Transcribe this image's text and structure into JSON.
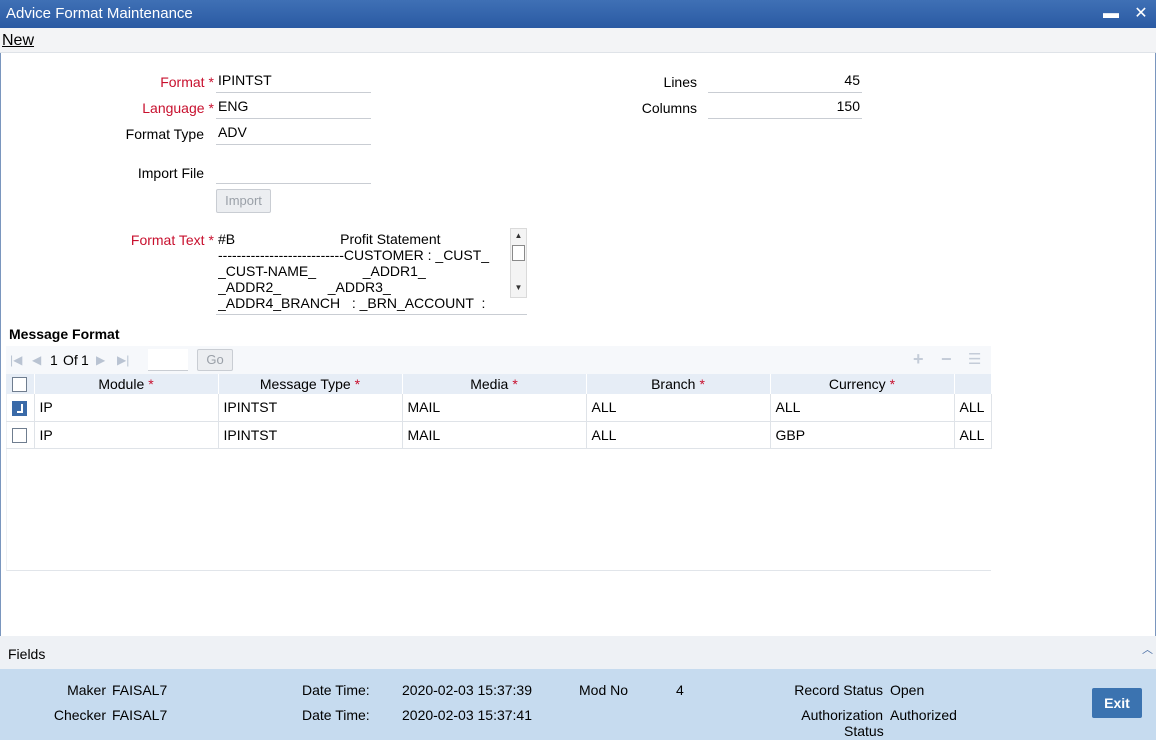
{
  "window": {
    "title": "Advice Format Maintenance",
    "minimize": "▬",
    "close": "✕"
  },
  "menu": {
    "new_label": "New"
  },
  "form": {
    "format_label": "Format",
    "format_value": "IPINTST",
    "language_label": "Language",
    "language_value": "ENG",
    "format_type_label": "Format Type",
    "format_type_value": "ADV",
    "import_file_label": "Import File",
    "import_file_value": "",
    "import_button": "Import",
    "format_text_label": "Format Text",
    "format_text_lines": [
      "#B                           Profit Statement",
      "---------------------------CUSTOMER : _CUST_",
      "_CUST-NAME_            _ADDR1_",
      "_ADDR2_            _ADDR3_",
      "_ADDR4_BRANCH   : _BRN_ACCOUNT  :"
    ],
    "lines_label": "Lines",
    "lines_value": "45",
    "columns_label": "Columns",
    "columns_value": "150",
    "required_mark": "*"
  },
  "message_format": {
    "title": "Message Format",
    "pager": {
      "current": "1",
      "of_label": "Of",
      "total": "1",
      "go_label": "Go"
    },
    "columns": [
      "Module",
      "Message Type",
      "Media",
      "Branch",
      "Currency"
    ],
    "rows": [
      {
        "checked": true,
        "module": "IP",
        "message_type": "IPINTST",
        "media": "MAIL",
        "branch": "ALL",
        "currency": "ALL",
        "extra": "ALL"
      },
      {
        "checked": false,
        "module": "IP",
        "message_type": "IPINTST",
        "media": "MAIL",
        "branch": "ALL",
        "currency": "GBP",
        "extra": "ALL"
      }
    ]
  },
  "fields_bar": {
    "label": "Fields"
  },
  "audit": {
    "maker_label": "Maker",
    "maker_value": "FAISAL7",
    "checker_label": "Checker",
    "checker_value": "FAISAL7",
    "date_time_label": "Date Time:",
    "maker_date": "2020-02-03 15:37:39",
    "checker_date": "2020-02-03 15:37:41",
    "mod_no_label": "Mod No",
    "mod_no_value": "4",
    "record_status_label": "Record Status",
    "record_status_value": "Open",
    "auth_status_label_1": "Authorization",
    "auth_status_label_2": "Status",
    "auth_status_value": "Authorized",
    "exit_label": "Exit"
  }
}
